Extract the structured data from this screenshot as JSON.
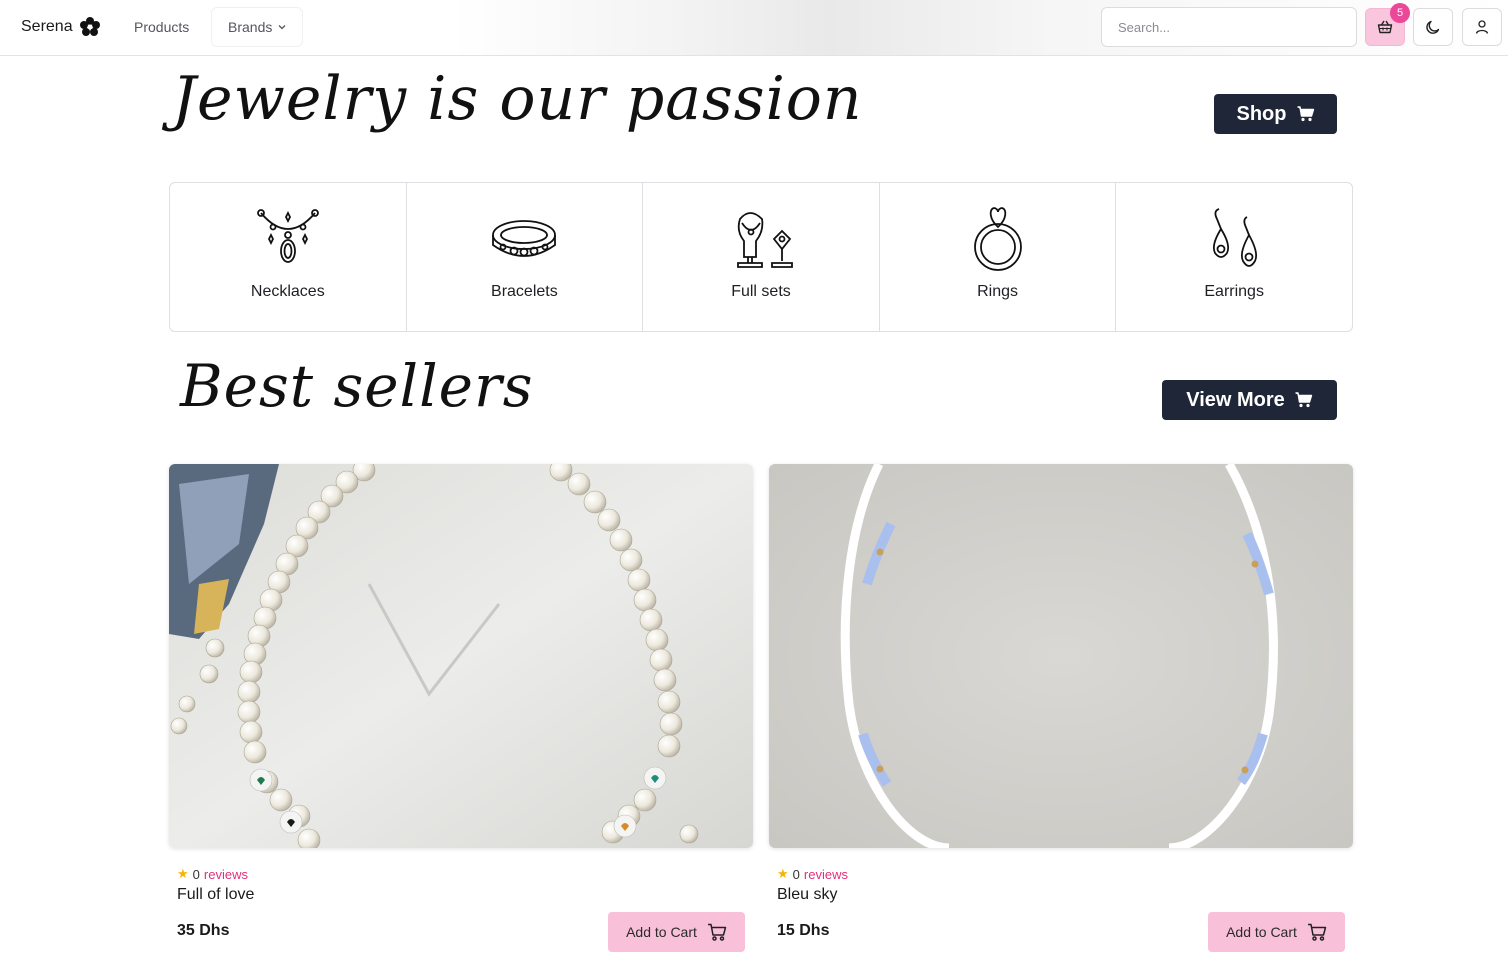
{
  "navbar": {
    "brand": "Serena",
    "links": {
      "products": "Products",
      "brands": "Brands"
    },
    "search_placeholder": "Search...",
    "cart_count": "5",
    "icons": {
      "logo": "flower-logo-icon",
      "cart": "basket-icon",
      "theme": "moon-icon",
      "user": "user-icon"
    }
  },
  "hero": {
    "title": "Jewelry is our passion",
    "shop_label": "Shop"
  },
  "categories": [
    {
      "label": "Necklaces",
      "icon": "necklace-icon"
    },
    {
      "label": "Bracelets",
      "icon": "bracelet-icon"
    },
    {
      "label": "Full sets",
      "icon": "jewelry-set-icon"
    },
    {
      "label": "Rings",
      "icon": "ring-icon"
    },
    {
      "label": "Earrings",
      "icon": "earrings-icon"
    }
  ],
  "best_sellers": {
    "title": "Best sellers",
    "view_more_label": "View More"
  },
  "products": [
    {
      "name": "Full of love",
      "price": "35 Dhs",
      "review_count": "0",
      "reviews_label": "reviews",
      "add_label": "Add to Cart"
    },
    {
      "name": "Bleu sky",
      "price": "15 Dhs",
      "review_count": "0",
      "reviews_label": "reviews",
      "add_label": "Add to Cart"
    }
  ],
  "colors": {
    "accent_pink": "#f9c0da",
    "badge_pink": "#ec4899",
    "dark_button": "#1f2637",
    "star": "#f5b400"
  }
}
